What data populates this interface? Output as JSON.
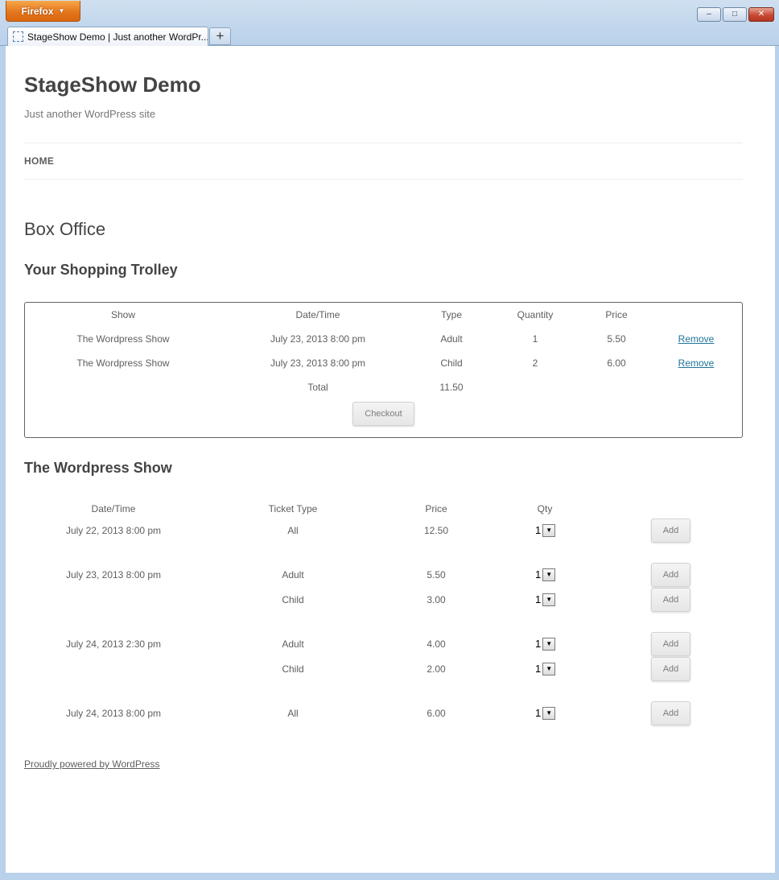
{
  "browser": {
    "app_button": "Firefox",
    "tab_title": "StageShow Demo | Just another WordPr...",
    "new_tab": "+",
    "controls": {
      "minimize": "–",
      "maximize": "□",
      "close": "✕"
    }
  },
  "site": {
    "title": "StageShow Demo",
    "description": "Just another WordPress site",
    "nav_home": "HOME"
  },
  "page": {
    "title": "Box Office"
  },
  "trolley": {
    "heading": "Your Shopping Trolley",
    "headers": {
      "show": "Show",
      "datetime": "Date/Time",
      "type": "Type",
      "quantity": "Quantity",
      "price": "Price"
    },
    "rows": [
      {
        "show": "The Wordpress Show",
        "datetime": "July 23, 2013 8:00 pm",
        "type": "Adult",
        "quantity": "1",
        "price": "5.50",
        "action": "Remove"
      },
      {
        "show": "The Wordpress Show",
        "datetime": "July 23, 2013 8:00 pm",
        "type": "Child",
        "quantity": "2",
        "price": "6.00",
        "action": "Remove"
      }
    ],
    "total_label": "Total",
    "total_value": "11.50",
    "checkout": "Checkout"
  },
  "show": {
    "heading": "The Wordpress Show",
    "headers": {
      "datetime": "Date/Time",
      "ticket_type": "Ticket Type",
      "price": "Price",
      "qty": "Qty"
    },
    "rows": [
      {
        "datetime": "July 22, 2013 8:00 pm",
        "type": "All",
        "price": "12.50",
        "qty": "1",
        "add": "Add"
      },
      {
        "datetime": "July 23, 2013 8:00 pm",
        "type": "Adult",
        "price": "5.50",
        "qty": "1",
        "add": "Add"
      },
      {
        "datetime": "",
        "type": "Child",
        "price": "3.00",
        "qty": "1",
        "add": "Add"
      },
      {
        "datetime": "July 24, 2013 2:30 pm",
        "type": "Adult",
        "price": "4.00",
        "qty": "1",
        "add": "Add"
      },
      {
        "datetime": "",
        "type": "Child",
        "price": "2.00",
        "qty": "1",
        "add": "Add"
      },
      {
        "datetime": "July 24, 2013 8:00 pm",
        "type": "All",
        "price": "6.00",
        "qty": "1",
        "add": "Add"
      }
    ]
  },
  "footer": {
    "powered_by": "Proudly powered by WordPress"
  }
}
